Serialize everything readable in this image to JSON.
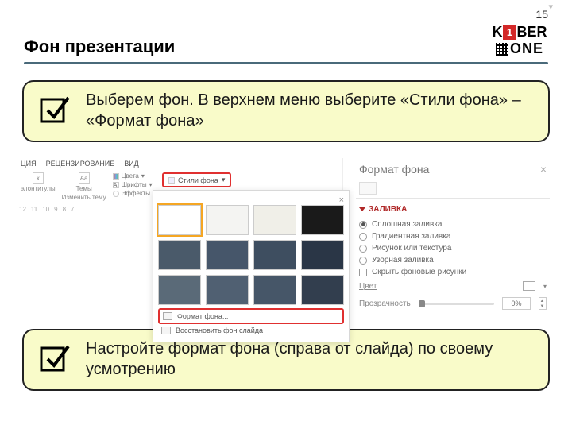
{
  "page_number": "15",
  "title": "Фон презентации",
  "logo": {
    "k": "K",
    "one_badge": "1",
    "ber": "BER",
    "one": "ONE"
  },
  "callout1": "Выберем фон. В верхнем меню выберите «Стили фона» – «Формат фона»",
  "callout2": "Настройте формат фона (справа от слайда) по своему усмотрению",
  "ribbon": {
    "tabs": [
      "ЦИЯ",
      "РЕЦЕНЗИРОВАНИЕ",
      "ВИД"
    ],
    "colontitle": "элонтитулы",
    "themes_label": "Темы",
    "change_theme": "Изменить тему",
    "aa": "Aa",
    "colors": "Цвета",
    "fonts": "Шрифты",
    "effects": "Эффекты",
    "styles_button": "Стили фона",
    "ruler": [
      "12",
      "11",
      "10",
      "9",
      "8",
      "7"
    ]
  },
  "dropdown": {
    "close_x": "×",
    "format_bg": "Формат фона...",
    "restore_bg": "Восстановить фон слайда"
  },
  "pane": {
    "title": "Формат фона",
    "section": "ЗАЛИВКА",
    "opts": [
      "Сплошная заливка",
      "Градиентная заливка",
      "Рисунок или текстура",
      "Узорная заливка"
    ],
    "hide_bg": "Скрыть фоновые рисунки",
    "color_label": "Цвет",
    "trans_label": "Прозрачность",
    "trans_value": "0%"
  },
  "style_cells": [
    {
      "bg": "#ffffff",
      "sel": true
    },
    {
      "bg": "#f4f4f2"
    },
    {
      "bg": "#f0efe8"
    },
    {
      "bg": "#1a1a1a"
    },
    {
      "bg": "#4a5a6a"
    },
    {
      "bg": "#46566a"
    },
    {
      "bg": "#3e4e60"
    },
    {
      "bg": "#2a3646"
    },
    {
      "bg": "#5a6a78"
    },
    {
      "bg": "#506072"
    },
    {
      "bg": "#465668"
    },
    {
      "bg": "#323e4e"
    }
  ]
}
